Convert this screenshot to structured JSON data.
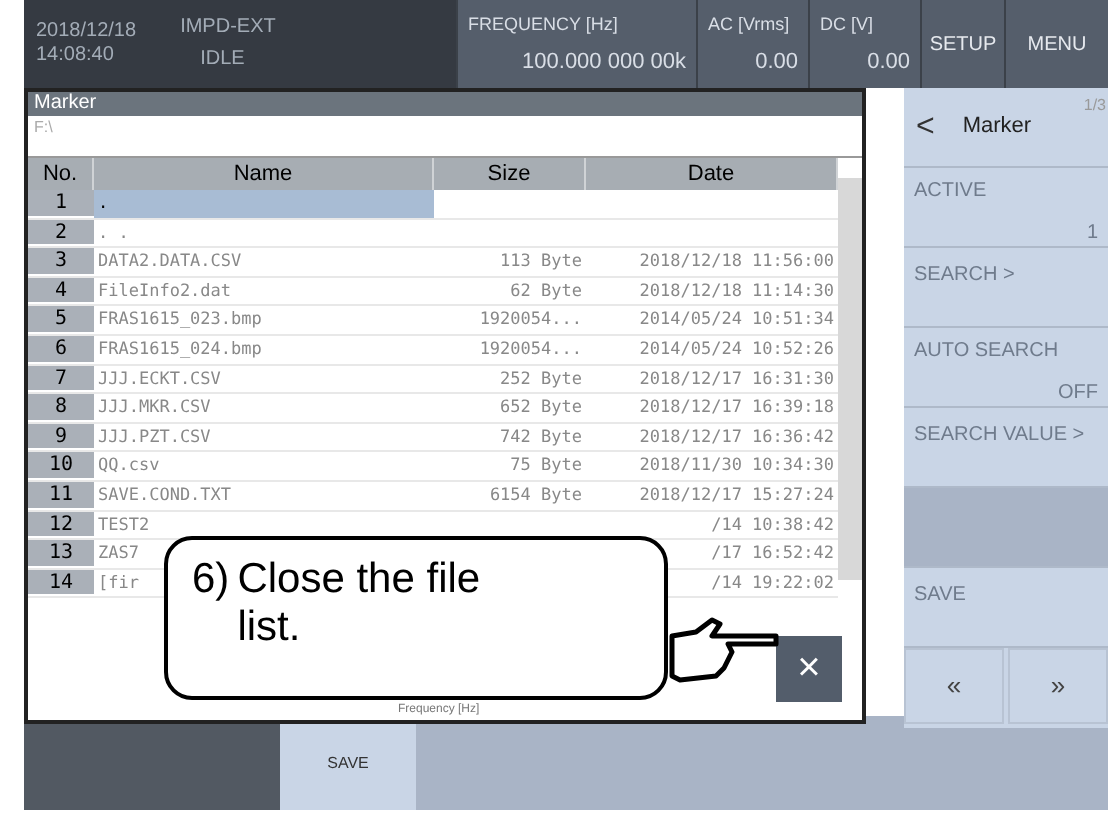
{
  "status_bar": {
    "date": "2018/12/18",
    "time": "14:08:40",
    "mode": "IMPD-EXT",
    "state": "IDLE",
    "readouts": [
      {
        "label": "FREQUENCY [Hz]",
        "value": "100.000 000 00k"
      },
      {
        "label": "AC [Vrms]",
        "value": "0.00"
      },
      {
        "label": "DC [V]",
        "value": "0.00"
      }
    ],
    "buttons": [
      "SETUP",
      "MENU"
    ]
  },
  "dialog": {
    "title": "Marker",
    "path": "F:\\",
    "columns": [
      "No.",
      "Name",
      "Size",
      "Date"
    ],
    "rows": [
      {
        "no": "1",
        "name": ".",
        "size": "",
        "date": "",
        "selected": true
      },
      {
        "no": "2",
        "name": ". .",
        "size": "",
        "date": "",
        "selected": false
      },
      {
        "no": "3",
        "name": "DATA2.DATA.CSV",
        "size": "113 Byte",
        "date": "2018/12/18 11:56:00",
        "selected": false
      },
      {
        "no": "4",
        "name": "FileInfo2.dat",
        "size": "62 Byte",
        "date": "2018/12/18 11:14:30",
        "selected": false
      },
      {
        "no": "5",
        "name": "FRAS1615_023.bmp",
        "size": "1920054...",
        "date": "2014/05/24 10:51:34",
        "selected": false
      },
      {
        "no": "6",
        "name": "FRAS1615_024.bmp",
        "size": "1920054...",
        "date": "2014/05/24 10:52:26",
        "selected": false
      },
      {
        "no": "7",
        "name": "JJJ.ECKT.CSV",
        "size": "252 Byte",
        "date": "2018/12/17 16:31:30",
        "selected": false
      },
      {
        "no": "8",
        "name": "JJJ.MKR.CSV",
        "size": "652 Byte",
        "date": "2018/12/17 16:39:18",
        "selected": false
      },
      {
        "no": "9",
        "name": "JJJ.PZT.CSV",
        "size": "742 Byte",
        "date": "2018/12/17 16:36:42",
        "selected": false
      },
      {
        "no": "10",
        "name": "QQ.csv",
        "size": "75 Byte",
        "date": "2018/11/30 10:34:30",
        "selected": false
      },
      {
        "no": "11",
        "name": "SAVE.COND.TXT",
        "size": "6154 Byte",
        "date": "2018/12/17 15:27:24",
        "selected": false
      },
      {
        "no": "12",
        "name": "TEST2",
        "size": "",
        "date": "/14 10:38:42",
        "selected": false
      },
      {
        "no": "13",
        "name": "ZAS7",
        "size": "",
        "date": "/17 16:52:42",
        "selected": false
      },
      {
        "no": "14",
        "name": "[fir",
        "size": "",
        "date": "/14 19:22:02",
        "selected": false
      }
    ],
    "close_button": "×",
    "background_text": "Frequency [Hz]"
  },
  "callout": {
    "number": "6)",
    "text": "Close the file list."
  },
  "side_panel": {
    "title": "Marker",
    "page": "1/3",
    "back": "<",
    "items": [
      {
        "label": "ACTIVE",
        "value": "1",
        "kind": "value"
      },
      {
        "label": "SEARCH >",
        "kind": "plain"
      },
      {
        "label": "AUTO SEARCH",
        "value": "OFF",
        "kind": "value"
      },
      {
        "label": "SEARCH VALUE >",
        "kind": "plain"
      },
      {
        "kind": "blank"
      },
      {
        "label": "SAVE",
        "kind": "plain"
      }
    ],
    "nav": [
      "«",
      "»"
    ]
  },
  "bottom_bar": {
    "buttons": [
      "SAVE"
    ]
  }
}
